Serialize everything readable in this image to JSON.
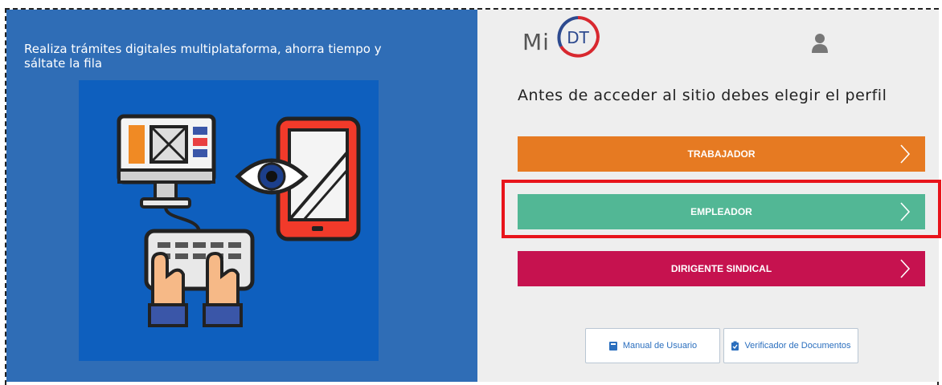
{
  "left_panel": {
    "tagline": "Realiza trámites digitales multiplataforma, ahorra tiempo y sáltate la fila"
  },
  "logo": {
    "text_mi": "Mi",
    "text_dt": "DT"
  },
  "header": {
    "user_icon": "user-icon"
  },
  "profile_prompt": "Antes de acceder al sitio debes elegir el perfil",
  "roles": [
    {
      "label": "TRABAJADOR",
      "color": "#e67a22"
    },
    {
      "label": "EMPLEADOR",
      "color": "#52b795"
    },
    {
      "label": "DIRIGENTE SINDICAL",
      "color": "#c6124f"
    }
  ],
  "links": {
    "manual": {
      "label": "Manual de Usuario",
      "icon": "book-icon"
    },
    "verifier": {
      "label": "Verificador de Documentos",
      "icon": "clipboard-check-icon"
    }
  },
  "colors": {
    "left_bg": "#2f6db6",
    "illustration_bg": "#0e5fbe",
    "right_bg": "#eeeeee",
    "highlight": "#e8141b",
    "link_text": "#2b6fbe"
  }
}
